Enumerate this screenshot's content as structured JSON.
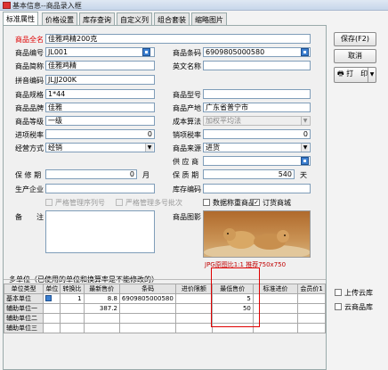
{
  "window": {
    "title": "基本信息--商品录入框"
  },
  "tabs": [
    "标准属性",
    "价格设置",
    "库存查询",
    "自定义列",
    "组合套装",
    "缩略图片"
  ],
  "fields": {
    "name_label": "商品全名",
    "name_value": "佳雅鸡精200克",
    "code_label": "商品编号",
    "code_value": "JL001",
    "barcode_label": "商品条码",
    "barcode_value": "6909805000580",
    "short_label": "商品简称",
    "short_value": "佳雅鸡精",
    "en_label": "英文名称",
    "en_value": "",
    "pinyin_label": "拼音编码",
    "pinyin_value": "JLJJ200K",
    "spec_label": "商品规格",
    "spec_value": "1*44",
    "model_label": "商品型号",
    "model_value": "",
    "brand_label": "商品品牌",
    "brand_value": "佳雅",
    "origin_label": "商品产地",
    "origin_value": "广东省普宁市",
    "grade_label": "商品等级",
    "grade_value": "一级",
    "cost_label": "成本算法",
    "cost_value": "加权平均法",
    "intax_label": "进项税率",
    "intax_value": "0",
    "outtax_label": "销项税率",
    "outtax_value": "0",
    "mode_label": "经营方式",
    "mode_value": "经销",
    "source_label": "商品来源",
    "source_value": "进货",
    "supplier_label": "供 应 商",
    "supplier_value": "",
    "warranty_label": "保 修 期",
    "warranty_value": "0",
    "warranty_unit": "月",
    "shelf_label": "保 质 期",
    "shelf_value": "540",
    "shelf_unit": "天",
    "maker_label": "生产企业",
    "maker_value": "",
    "location_label": "库存编码",
    "location_value": "",
    "remark_label": "备　　注",
    "remark_value": "",
    "image_label": "商品图影"
  },
  "checks": {
    "serial": "严格管理序列号",
    "batch": "严格管理多号批次",
    "weigh": "数据称重商品",
    "order": "订货商城"
  },
  "image": {
    "caption": "JPG原图比1:1 推荐750x750"
  },
  "multi_unit": {
    "title": "多单位（已使用的单位和换算率是不能修改的）",
    "headers": [
      "单位类型",
      "单位",
      "转换比",
      "最新售价",
      "条码",
      "进价限额",
      "最低售价",
      "标准进价",
      "会员价1"
    ],
    "rows": [
      {
        "type": "基本单位",
        "unit": "",
        "rate": "1",
        "price": "8.8",
        "barcode": "6909805000580",
        "limit": "",
        "min_price": "5",
        "std": "",
        "member": ""
      },
      {
        "type": "辅助单位一",
        "unit": "",
        "rate": "",
        "price": "387.2",
        "barcode": "",
        "limit": "",
        "min_price": "50",
        "std": "",
        "member": ""
      },
      {
        "type": "辅助单位二",
        "unit": "",
        "rate": "",
        "price": "",
        "barcode": "",
        "limit": "",
        "min_price": "",
        "std": "",
        "member": ""
      },
      {
        "type": "辅助单位三",
        "unit": "",
        "rate": "",
        "price": "",
        "barcode": "",
        "limit": "",
        "min_price": "",
        "std": "",
        "member": ""
      }
    ]
  },
  "buttons": {
    "save": "保存(F2)",
    "cancel": "取消",
    "print": "打　印"
  },
  "side_checks": {
    "upload": "上传云库",
    "cloud": "云商品库"
  }
}
